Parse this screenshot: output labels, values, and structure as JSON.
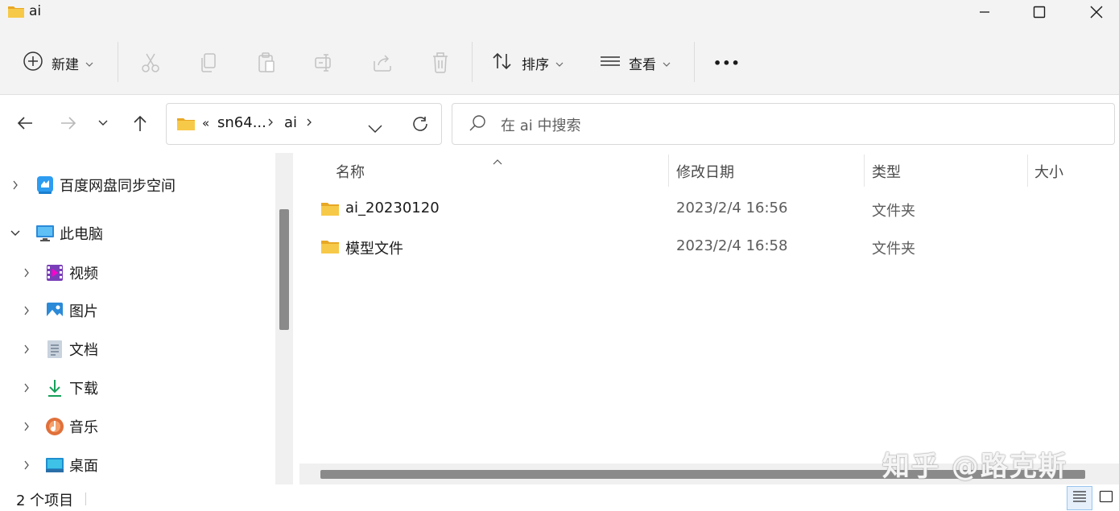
{
  "window": {
    "title": "ai"
  },
  "toolbar": {
    "new_label": "新建",
    "sort_label": "排序",
    "view_label": "查看",
    "more_label": "•••"
  },
  "address": {
    "overflow": "«",
    "crumbs": [
      "sn64...",
      "ai"
    ]
  },
  "search": {
    "placeholder": "在 ai 中搜索"
  },
  "nav": {
    "items": [
      {
        "label": "百度网盘同步空间",
        "icon": "baidu-netdisk-icon"
      },
      {
        "label": "此电脑",
        "icon": "computer-icon"
      },
      {
        "label": "视频",
        "icon": "videos-icon"
      },
      {
        "label": "图片",
        "icon": "pictures-icon"
      },
      {
        "label": "文档",
        "icon": "documents-icon"
      },
      {
        "label": "下载",
        "icon": "downloads-icon"
      },
      {
        "label": "音乐",
        "icon": "music-icon"
      },
      {
        "label": "桌面",
        "icon": "desktop-icon"
      }
    ]
  },
  "columns": {
    "name": "名称",
    "date": "修改日期",
    "type": "类型",
    "size": "大小"
  },
  "files": [
    {
      "name": "ai_20230120",
      "date": "2023/2/4 16:56",
      "type": "文件夹"
    },
    {
      "name": "模型文件",
      "date": "2023/2/4 16:58",
      "type": "文件夹"
    }
  ],
  "status": {
    "count": "2 个项目"
  },
  "watermark": "知乎 @路克斯",
  "colors": {
    "folder": "#f4c542",
    "accent": "#0067c0"
  }
}
